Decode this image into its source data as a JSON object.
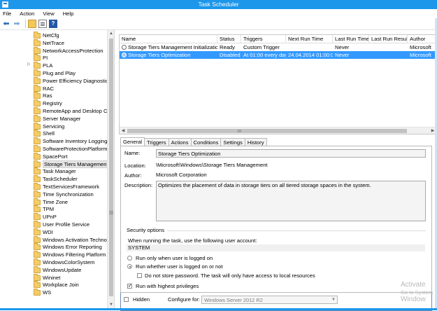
{
  "window": {
    "title": "Task Scheduler"
  },
  "menu": [
    "File",
    "Action",
    "View",
    "Help"
  ],
  "toolbar": {
    "back_icon": "back-arrow-icon",
    "forward_icon": "forward-arrow-icon"
  },
  "tree": {
    "items": [
      {
        "label": "NetCfg"
      },
      {
        "label": "NetTrace"
      },
      {
        "label": "NetworkAccessProtection"
      },
      {
        "label": "PI"
      },
      {
        "label": "PLA",
        "expandable": true
      },
      {
        "label": "Plug and Play"
      },
      {
        "label": "Power Efficiency Diagnostics"
      },
      {
        "label": "RAC"
      },
      {
        "label": "Ras"
      },
      {
        "label": "Registry"
      },
      {
        "label": "RemoteApp and Desktop Cor"
      },
      {
        "label": "Server Manager"
      },
      {
        "label": "Servicing"
      },
      {
        "label": "Shell"
      },
      {
        "label": "Software Inventory Logging"
      },
      {
        "label": "SoftwareProtectionPlatform"
      },
      {
        "label": "SpacePort"
      },
      {
        "label": "Storage Tiers Management",
        "selected": true
      },
      {
        "label": "Task Manager"
      },
      {
        "label": "TaskScheduler"
      },
      {
        "label": "TextServicesFramework"
      },
      {
        "label": "Time Synchronization"
      },
      {
        "label": "Time Zone"
      },
      {
        "label": "TPM"
      },
      {
        "label": "UPnP"
      },
      {
        "label": "User Profile Service"
      },
      {
        "label": "WDI"
      },
      {
        "label": "Windows Activation Technol"
      },
      {
        "label": "Windows Error Reporting"
      },
      {
        "label": "Windows Filtering Platform"
      },
      {
        "label": "WindowsColorSystem"
      },
      {
        "label": "WindowsUpdate"
      },
      {
        "label": "Wininet"
      },
      {
        "label": "Workplace Join"
      },
      {
        "label": "WS"
      }
    ]
  },
  "tasks": {
    "columns": [
      "Name",
      "Status",
      "Triggers",
      "Next Run Time",
      "Last Run Time",
      "Last Run Result",
      "Author"
    ],
    "rows": [
      {
        "name": "Storage Tiers Management Initialization",
        "status": "Ready",
        "triggers": "Custom Trigger",
        "next": "",
        "last": "Never",
        "result": "",
        "author": "Microsoft"
      },
      {
        "name": "Storage Tiers Optimization",
        "status": "Disabled",
        "triggers": "At 01:00 every day",
        "next": "24.04.2014 01:00:00",
        "last": "Never",
        "result": "",
        "author": "Microsoft",
        "selected": true
      }
    ]
  },
  "tabs": [
    "General",
    "Triggers",
    "Actions",
    "Conditions",
    "Settings",
    "History"
  ],
  "general": {
    "name_label": "Name:",
    "name_value": "Storage Tiers Optimization",
    "location_label": "Location:",
    "location_value": "\\Microsoft\\Windows\\Storage Tiers Management",
    "author_label": "Author:",
    "author_value": "Microsoft Corporation",
    "description_label": "Description:",
    "description_value": "Optimizes the placement of data in storage tiers on all tiered storage spaces in the system.",
    "security_title": "Security options",
    "account_prompt": "When running the task, use the following user account:",
    "account_value": "SYSTEM",
    "run_logged_on": "Run only when user is logged on",
    "run_whether": "Run whether user is logged on or not",
    "no_store_password": "Do not store password.  The task will only have access to local resources",
    "highest_privileges": "Run with highest privileges",
    "hidden_label": "Hidden",
    "configure_label": "Configure for:",
    "configure_value": "Windows Server 2012 R2"
  },
  "watermark": {
    "line1": "Activate",
    "line2": "Go to System",
    "line3": "Window"
  },
  "colors": {
    "titlebar": "#1c97ea",
    "selection": "#3399ff"
  }
}
